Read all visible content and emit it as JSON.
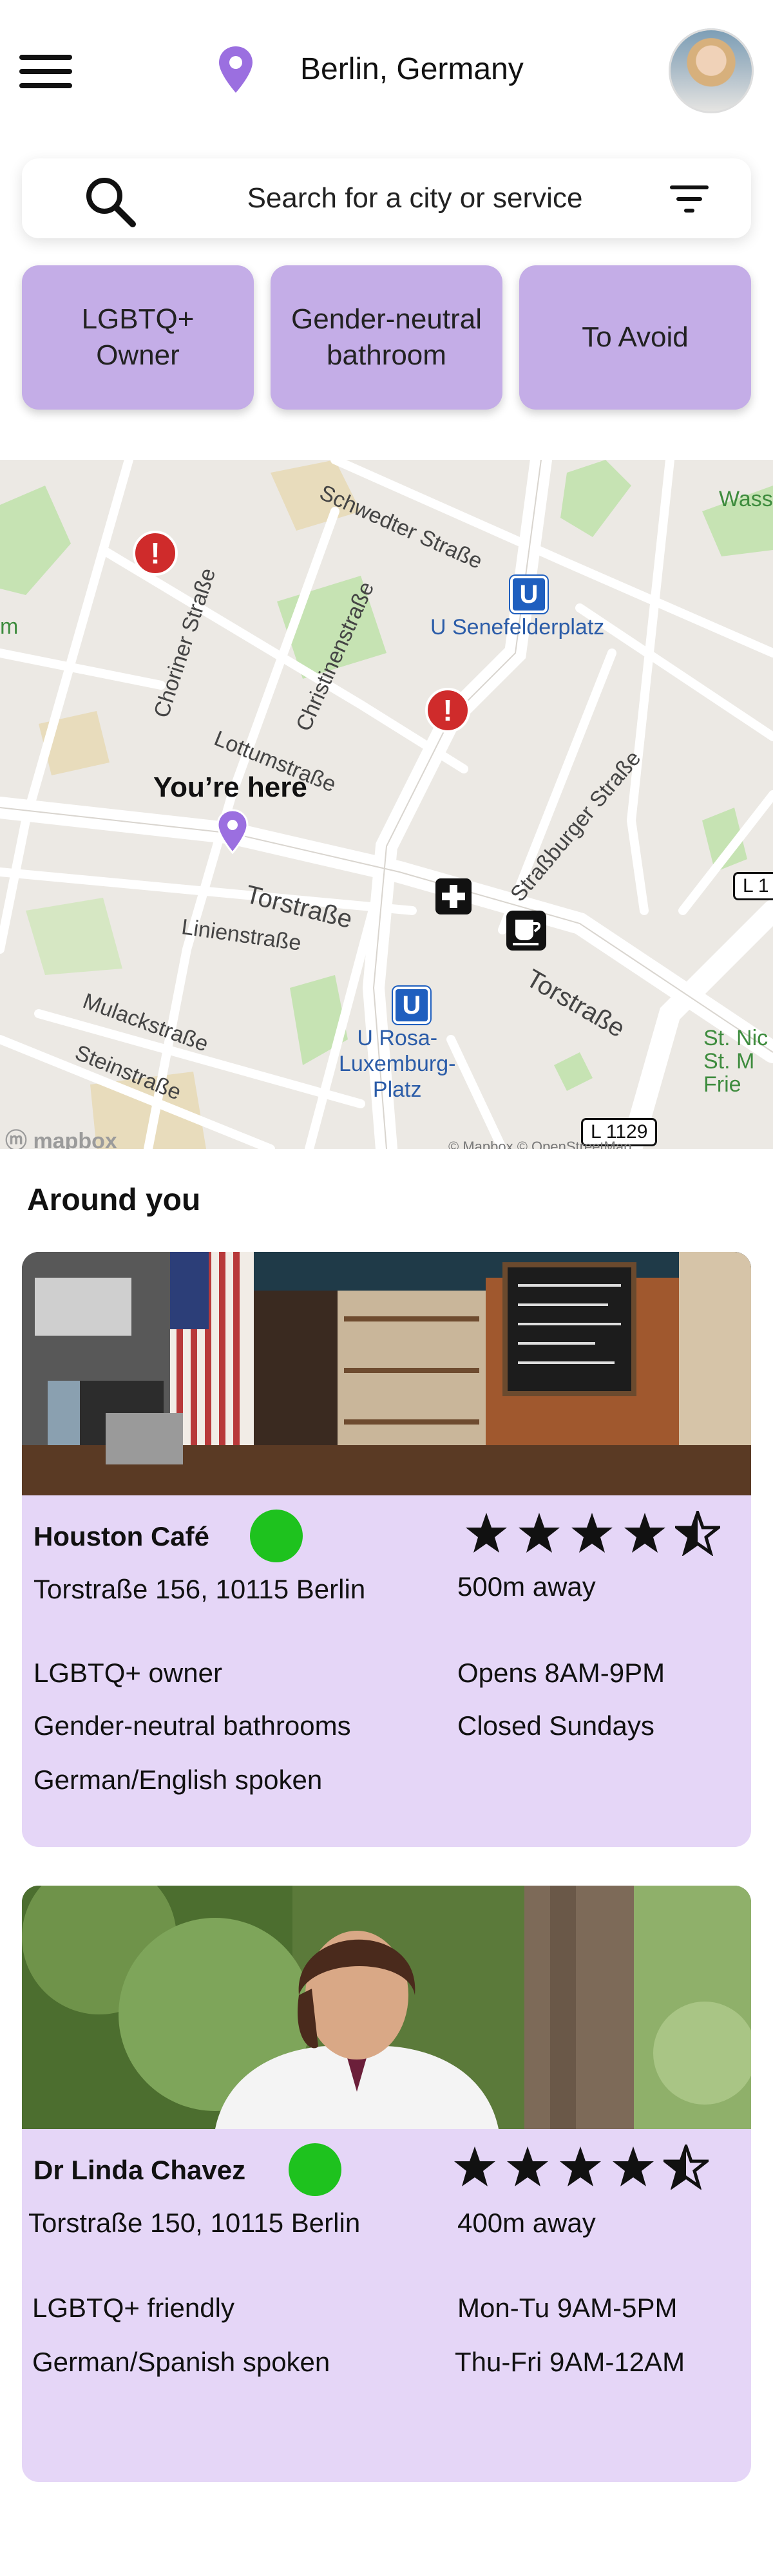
{
  "header": {
    "location": "Berlin, Germany",
    "menu_icon": "hamburger-menu-icon",
    "location_icon": "location-pin-icon",
    "avatar_icon": "user-avatar"
  },
  "search": {
    "placeholder": "Search for a city or service",
    "search_icon": "search-icon",
    "filter_icon": "filter-icon"
  },
  "filters": [
    "LGBTQ+\nOwner",
    "Gender-neutral\nbathroom",
    "To Avoid"
  ],
  "map": {
    "streets": [
      "Schwedter Straße",
      "Choriner Straße",
      "Christinenstraße",
      "Lottumstraße",
      "Straßburger Straße",
      "Torstraße",
      "Linienstraße",
      "Torstraße",
      "Mulackstraße",
      "Steinstraße"
    ],
    "stations": [
      "U Senefelderplatz",
      "U Rosa-\nLuxemburg-\nPlatz"
    ],
    "place_labels": [
      "Wass",
      "St. Nic\nSt. M\nFrie",
      "m"
    ],
    "you_are_here": "You’re here",
    "road_shields": [
      "L 1129",
      "L 1"
    ],
    "mapbox": "mapbox",
    "attribution": "© Mapbox © OpenStreetMap"
  },
  "around_you": {
    "title": "Around you",
    "places": [
      {
        "name": "Houston Café",
        "address": "Torstraße 156, 10115 Berlin",
        "distance": "500m away",
        "rating": 4.5,
        "open": true,
        "features": [
          "LGBTQ+ owner",
          "Gender-neutral bathrooms",
          "German/English spoken"
        ],
        "hours": [
          "Opens 8AM-9PM",
          "Closed Sundays"
        ]
      },
      {
        "name": "Dr Linda Chavez",
        "address": "Torstraße 150, 10115 Berlin",
        "distance": "400m away",
        "rating": 4.5,
        "open": true,
        "features": [
          "LGBTQ+ friendly",
          "German/Spanish spoken"
        ],
        "hours": [
          "Mon-Tu 9AM-5PM",
          "Thu-Fri 9AM-12AM"
        ]
      }
    ]
  },
  "colors": {
    "accent": "#c4ade7",
    "card_bg": "#e5d6f7",
    "pin_purple": "#9b6fe0",
    "open_green": "#1ec21e",
    "warning_red": "#cf2b2b",
    "ubahn_blue": "#1f5fbf"
  }
}
